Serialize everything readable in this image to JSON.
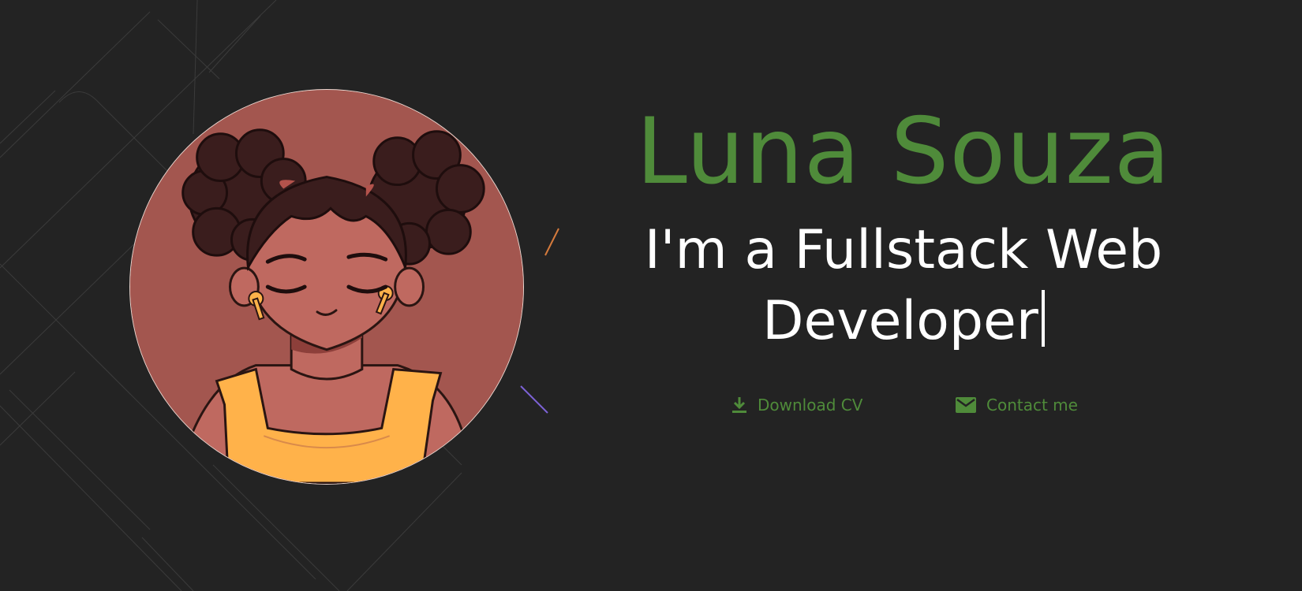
{
  "profile": {
    "name": "Luna Souza",
    "tagline": "I'm a Fullstack Web Developer",
    "avatar_icon": "girl-avatar-illustration"
  },
  "actions": {
    "download_label": "Download CV",
    "download_icon": "download-icon",
    "contact_label": "Contact me",
    "contact_icon": "mail-icon"
  },
  "colors": {
    "background": "#232323",
    "accent": "#4f8b3a",
    "text": "#ffffff",
    "avatar_bg": "#a3564f",
    "shirt": "#ffb24a"
  }
}
